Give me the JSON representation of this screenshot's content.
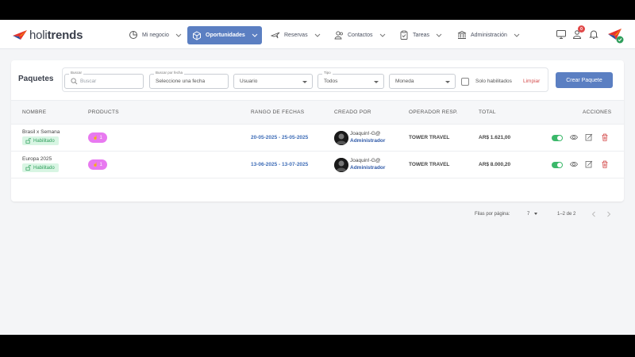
{
  "brand": {
    "pre": "holi",
    "bold": "trends"
  },
  "nav": [
    {
      "label": "Mi negocio",
      "icon": "pie-chart-icon"
    },
    {
      "label": "Oportunidades",
      "icon": "cube-icon",
      "active": true
    },
    {
      "label": "Reservas",
      "icon": "plane-icon"
    },
    {
      "label": "Contactos",
      "icon": "contacts-icon"
    },
    {
      "label": "Tareas",
      "icon": "clipboard-icon"
    },
    {
      "label": "Administración",
      "icon": "bank-icon"
    }
  ],
  "header_right": {
    "notification_count": "0"
  },
  "page": {
    "title": "Paquetes",
    "filters": {
      "search_label": "Buscar",
      "search_placeholder": "Buscar",
      "date_label": "Buscar por fecha",
      "date_placeholder": "Seleccione una fecha",
      "user_value": "Usuario",
      "type_label": "Tipo",
      "type_value": "Todos",
      "currency_value": "Moneda",
      "only_enabled_label": "Solo habilitados",
      "clear_label": "Limpiar"
    },
    "create_button": "Crear Paquete"
  },
  "table": {
    "headers": [
      "NOMBRE",
      "PRODUCTS",
      "RANGO DE FECHAS",
      "CREADO POR",
      "OPERADOR RESP.",
      "TOTAL",
      "ACCIONES"
    ],
    "rows": [
      {
        "name": "Brasil x Semana",
        "status": "Habilitado",
        "products": "1",
        "date_range": "20-05-2025 - 25-05-2025",
        "creator_name": "Joaquin!-G@",
        "creator_role": "Administrador",
        "operator": "TOWER TRAVEL",
        "total": "AR$ 1.621,00",
        "enabled": true
      },
      {
        "name": "Europa 2025",
        "status": "Habilitado",
        "products": "1",
        "date_range": "13-06-2025 - 13-07-2025",
        "creator_name": "Joaquin!-G@",
        "creator_role": "Administrador",
        "operator": "TOWER TRAVEL",
        "total": "AR$ 8.000,20",
        "enabled": true
      }
    ],
    "pagination": {
      "rows_per_page_label": "Filas por página:",
      "rows_per_page_value": "7",
      "range_text": "1–2 de 2"
    }
  },
  "colors": {
    "primary": "#5b7fc2",
    "success": "#3bb86a",
    "danger": "#d44c4c",
    "products_pill": "#e879f0"
  }
}
